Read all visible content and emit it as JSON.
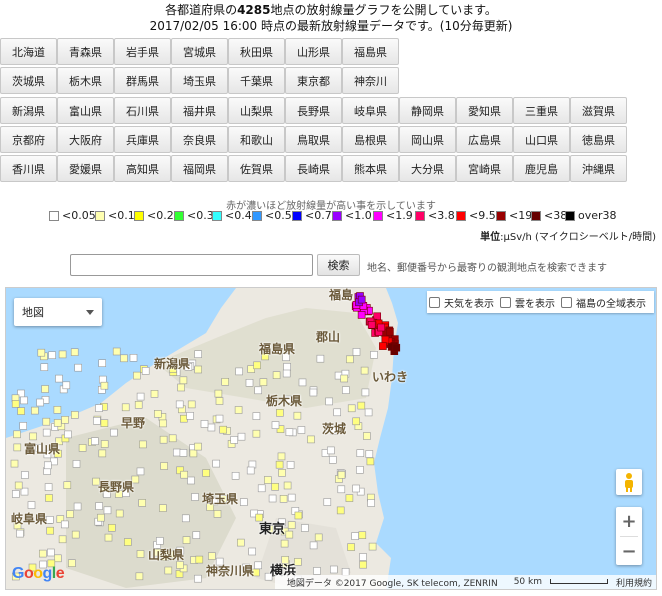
{
  "header": {
    "line1_prefix": "各都道府県の",
    "line1_count": "4285",
    "line1_suffix": "地点の放射線量グラフを公開しています。",
    "line2": "2017/02/05 16:00 時点の最新放射線量データです。(10分毎更新)"
  },
  "prefectures": [
    [
      "北海道",
      "青森県",
      "岩手県",
      "宮城県",
      "秋田県",
      "山形県",
      "福島県"
    ],
    [
      "茨城県",
      "栃木県",
      "群馬県",
      "埼玉県",
      "千葉県",
      "東京都",
      "神奈川"
    ],
    [
      "新潟県",
      "富山県",
      "石川県",
      "福井県",
      "山梨県",
      "長野県",
      "岐阜県",
      "静岡県",
      "愛知県",
      "三重県",
      "滋賀県"
    ],
    [
      "京都府",
      "大阪府",
      "兵庫県",
      "奈良県",
      "和歌山",
      "鳥取県",
      "島根県",
      "岡山県",
      "広島県",
      "山口県",
      "徳島県"
    ],
    [
      "香川県",
      "愛媛県",
      "高知県",
      "福岡県",
      "佐賀県",
      "長崎県",
      "熊本県",
      "大分県",
      "宮崎県",
      "鹿児島",
      "沖縄県"
    ]
  ],
  "legend": {
    "title": "赤が濃いほど放射線量が高い事を示しています",
    "items": [
      {
        "label": "<0.05",
        "color": "#ffffff"
      },
      {
        "label": "<0.1",
        "color": "#ffffb0"
      },
      {
        "label": "<0.2",
        "color": "#ffff00"
      },
      {
        "label": "<0.3",
        "color": "#33ff33"
      },
      {
        "label": "<0.4",
        "color": "#33ffff"
      },
      {
        "label": "<0.5",
        "color": "#3399ff"
      },
      {
        "label": "<0.7",
        "color": "#0000ff"
      },
      {
        "label": "<1.0",
        "color": "#9900ff"
      },
      {
        "label": "<1.9",
        "color": "#ff00ff"
      },
      {
        "label": "<3.8",
        "color": "#ff0066"
      },
      {
        "label": "<9.5",
        "color": "#ff0000"
      },
      {
        "label": "<19",
        "color": "#990000"
      },
      {
        "label": "<38",
        "color": "#660000"
      },
      {
        "label": "over38",
        "color": "#000000"
      }
    ],
    "unit_label": "単位",
    "unit_value": ":μSv/h (マイクロシーベルト/時間)"
  },
  "search": {
    "input_value": "",
    "button_label": "検索",
    "hint": "地名、郵便番号から最寄りの観測地点を検索できます"
  },
  "map": {
    "maptype_label": "地図",
    "options": [
      "天気を表示",
      "雲を表示",
      "福島の全域表示"
    ],
    "labels": {
      "fukushima_city": "福島",
      "koriyama": "郡山",
      "iwaki": "いわき",
      "fukushima_pref": "福島県",
      "niigata_pref": "新潟県",
      "tochigi": "栃木県",
      "ibaraki": "茨城",
      "toyama": "富山県",
      "nagano": "長野県",
      "saitama": "埼玉県",
      "tokyo": "東京",
      "yokohama": "横浜",
      "gifu": "岐阜県",
      "yamanashi": "山梨県",
      "kanagawa": "神奈川県",
      "hayano": "早野"
    },
    "zoom_in": "+",
    "zoom_out": "−",
    "google": "Google",
    "attribution": "地図データ ©2017 Google, SK telecom, ZENRIN",
    "scale": "50 km",
    "terms": "利用規約"
  }
}
